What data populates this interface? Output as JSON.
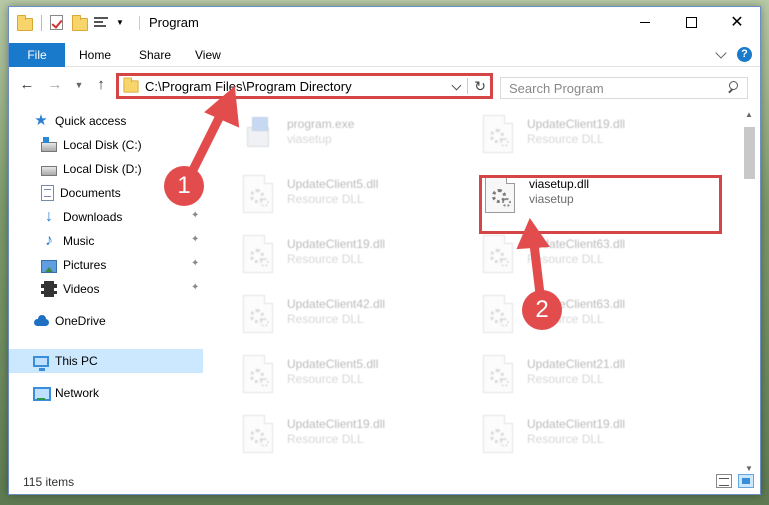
{
  "window": {
    "title": "Program"
  },
  "ribbon": {
    "tabs": [
      "File",
      "Home",
      "Share",
      "View"
    ]
  },
  "address": {
    "path": "C:\\Program Files\\Program Directory"
  },
  "search": {
    "placeholder": "Search Program"
  },
  "sidebar": {
    "items": [
      {
        "label": "Quick access",
        "icon": "star-icon"
      },
      {
        "label": "Local Disk (C:)",
        "icon": "local-disk-icon",
        "pinned": false
      },
      {
        "label": "Local Disk (D:)",
        "icon": "local-disk-icon",
        "pinned": false
      },
      {
        "label": "Documents",
        "icon": "documents-icon",
        "pinned": false
      },
      {
        "label": "Downloads",
        "icon": "downloads-icon",
        "pinned": true
      },
      {
        "label": "Music",
        "icon": "music-icon",
        "pinned": true
      },
      {
        "label": "Pictures",
        "icon": "pictures-icon",
        "pinned": true
      },
      {
        "label": "Videos",
        "icon": "videos-icon",
        "pinned": true
      },
      {
        "label": "OneDrive",
        "icon": "onedrive-icon"
      },
      {
        "label": "This PC",
        "icon": "this-pc-icon",
        "selected": true
      },
      {
        "label": "Network",
        "icon": "network-icon"
      }
    ]
  },
  "files": [
    {
      "name": "program.exe",
      "desc": "viasetup",
      "icon": "exe-icon"
    },
    {
      "name": "UpdateClient19.dll",
      "desc": "Resource DLL",
      "icon": "dll-icon"
    },
    {
      "name": "UpdateClient5.dll",
      "desc": "Resource DLL",
      "icon": "dll-icon"
    },
    {
      "name": "viasetup.dll",
      "desc": "viasetup",
      "icon": "dll-icon",
      "highlighted": true
    },
    {
      "name": "UpdateClient19.dll",
      "desc": "Resource DLL",
      "icon": "dll-icon"
    },
    {
      "name": "UpdateClient63.dll",
      "desc": "Resource DLL",
      "icon": "dll-icon"
    },
    {
      "name": "UpdateClient42.dll",
      "desc": "Resource DLL",
      "icon": "dll-icon"
    },
    {
      "name": "UpdateClient63.dll",
      "desc": "Resource DLL",
      "icon": "dll-icon"
    },
    {
      "name": "UpdateClient5.dll",
      "desc": "Resource DLL",
      "icon": "dll-icon"
    },
    {
      "name": "UpdateClient21.dll",
      "desc": "Resource DLL",
      "icon": "dll-icon"
    },
    {
      "name": "UpdateClient19.dll",
      "desc": "Resource DLL",
      "icon": "dll-icon"
    },
    {
      "name": "UpdateClient19.dll",
      "desc": "Resource DLL",
      "icon": "dll-icon"
    }
  ],
  "status": {
    "item_count": "115 items"
  },
  "annotations": {
    "step1": "1",
    "step2": "2",
    "color": "#e24c4c"
  }
}
